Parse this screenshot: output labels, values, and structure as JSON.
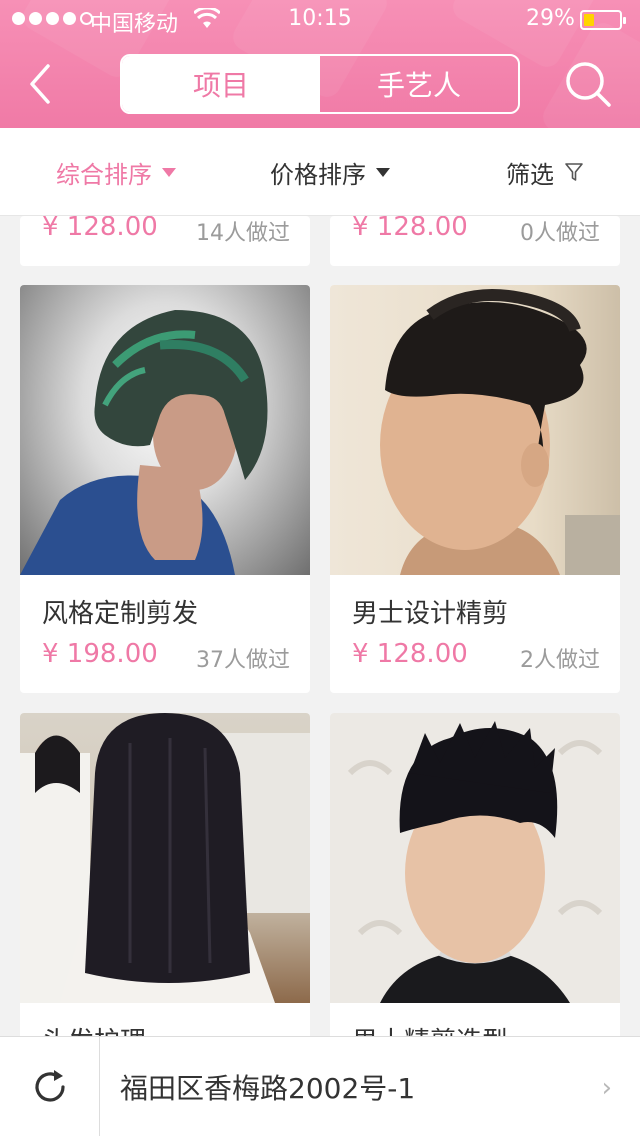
{
  "status_bar": {
    "carrier": "中国移动",
    "time": "10:15",
    "battery_percent_text": "29%",
    "battery_level": 0.29,
    "signal_bars_filled": 4,
    "signal_bars_total": 5
  },
  "header": {
    "tabs": [
      {
        "label": "项目",
        "active": true
      },
      {
        "label": "手艺人",
        "active": false
      }
    ],
    "back_icon": "chevron-left-icon",
    "search_icon": "search-icon"
  },
  "sortbar": {
    "items": [
      {
        "label": "综合排序",
        "selected": true,
        "icon": "caret-down-icon"
      },
      {
        "label": "价格排序",
        "selected": false,
        "icon": "caret-down-icon"
      },
      {
        "label": "筛选",
        "selected": false,
        "icon": "filter-icon"
      }
    ]
  },
  "products": [
    {
      "title": "",
      "price": "¥ 128.00",
      "count": "14人做过"
    },
    {
      "title": "",
      "price": "¥ 128.00",
      "count": "0人做过"
    },
    {
      "title": "风格定制剪发",
      "price": "¥ 198.00",
      "count": "37人做过"
    },
    {
      "title": "男士设计精剪",
      "price": "¥ 128.00",
      "count": "2人做过"
    },
    {
      "title": "头发护理",
      "price": "",
      "count": ""
    },
    {
      "title": "男士精剪造型",
      "price": "",
      "count": ""
    }
  ],
  "bottom_bar": {
    "address": "福田区香梅路2002号-1",
    "refresh_icon": "refresh-icon",
    "chevron_icon": "chevron-right-icon"
  },
  "colors": {
    "brand_pink": "#ef79a6",
    "header_pink": "#f48ab0",
    "battery_yellow": "#ffd400"
  }
}
